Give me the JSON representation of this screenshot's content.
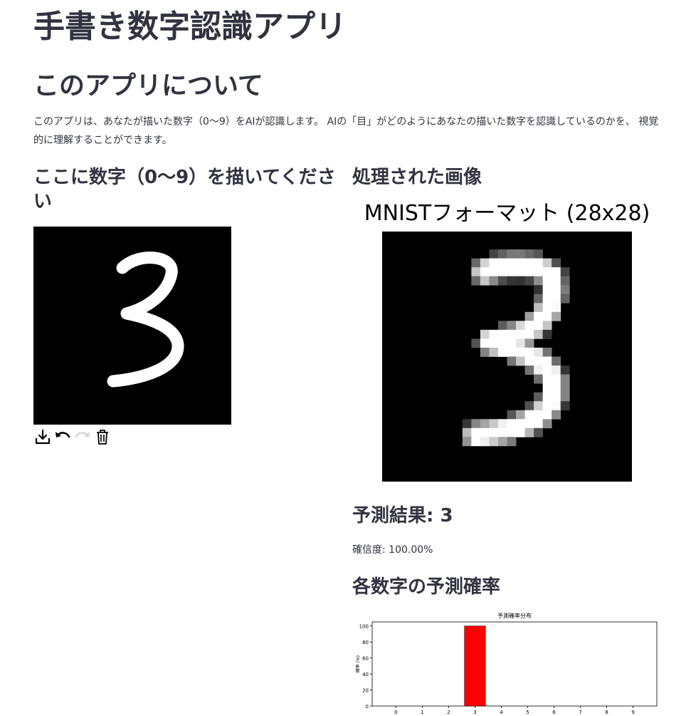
{
  "app": {
    "title": "手書き数字認識アプリ"
  },
  "about": {
    "heading": "このアプリについて",
    "text": "このアプリは、あなたが描いた数字（0〜9）をAIが認識します。 AIの「目」がどのようにあなたの描いた数字を認識しているのかを、 視覚的に理解することができます。"
  },
  "canvas": {
    "heading": "ここに数字（0〜9）を描いてください",
    "stroke_color": "#ffffff",
    "background_color": "#000000",
    "toolbar": {
      "download_icon": "download-icon",
      "undo_icon": "undo-icon",
      "redo_icon": "redo-icon",
      "delete_icon": "trash-icon"
    }
  },
  "processed": {
    "heading": "処理された画像",
    "figure_title": "MNISTフォーマット (28x28)"
  },
  "prediction": {
    "label": "予測結果: 3",
    "confidence": "確信度: 100.00%"
  },
  "probabilities": {
    "heading": "各数字の予測確率"
  },
  "chart_data": {
    "type": "bar",
    "title": "予測確率分布",
    "xlabel": "",
    "ylabel": "確率 (%)",
    "categories": [
      "0",
      "1",
      "2",
      "3",
      "4",
      "5",
      "6",
      "7",
      "8",
      "9"
    ],
    "values": [
      0,
      0,
      0,
      100,
      0,
      0,
      0,
      0,
      0,
      0
    ],
    "ylim": [
      0,
      105
    ],
    "yticks": [
      0,
      20,
      40,
      60,
      80,
      100
    ],
    "bar_color": "#ff0000",
    "grid": false
  }
}
